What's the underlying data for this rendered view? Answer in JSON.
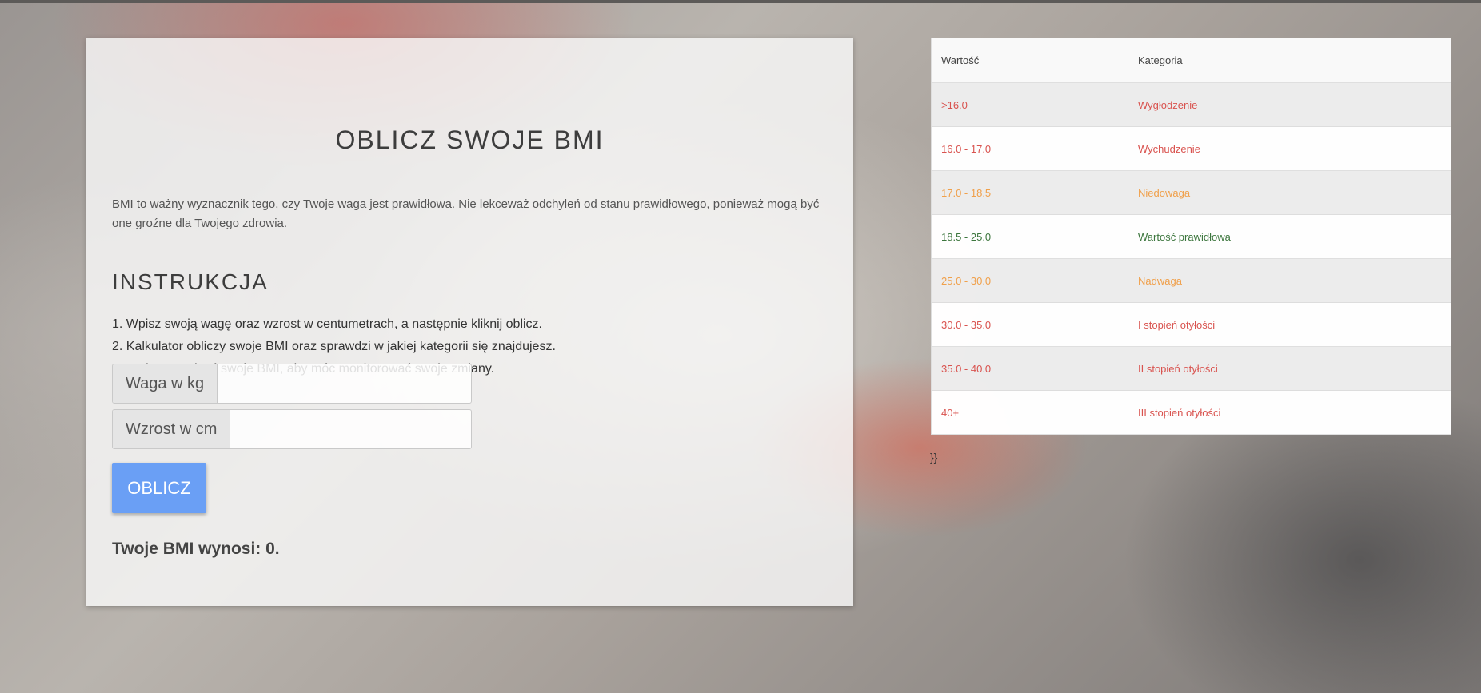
{
  "card": {
    "title": "OBLICZ SWOJE BMI",
    "intro": "BMI to ważny wyznacznik tego, czy Twoje waga jest prawidłowa. Nie lekceważ odchyleń od stanu prawidłowego, ponieważ mogą być one groźne dla Twojego zdrowia.",
    "instructions_title": "INSTRUKCJA",
    "steps": [
      "1. Wpisz swoją wagę oraz wzrost w centumetrach, a następnie kliknij oblicz.",
      "2. Kalkulator obliczy swoje BMI oraz sprawdzi w jakiej kategorii się znajdujesz.",
      "3. Możesz zapisać swoje BMI, aby móc monitorować swoje zmiany."
    ],
    "weight_label": "Waga w kg",
    "weight_value": "",
    "height_label": "Wzrost w cm",
    "height_value": "",
    "button_label": "OBLICZ",
    "result": "Twoje BMI wynosi: 0."
  },
  "table": {
    "headers": [
      "Wartość",
      "Kategoria"
    ],
    "rows": [
      {
        "value": ">16.0",
        "category": "Wygłodzenie",
        "color": "#d9534f"
      },
      {
        "value": "16.0 - 17.0",
        "category": "Wychudzenie",
        "color": "#d9534f"
      },
      {
        "value": "17.0 - 18.5",
        "category": "Niedowaga",
        "color": "#f0a04b"
      },
      {
        "value": "18.5 - 25.0",
        "category": "Wartość prawidłowa",
        "color": "#3c763d"
      },
      {
        "value": "25.0 - 30.0",
        "category": "Nadwaga",
        "color": "#f0a04b"
      },
      {
        "value": "30.0 - 35.0",
        "category": "I stopień otyłości",
        "color": "#d9534f"
      },
      {
        "value": "35.0 - 40.0",
        "category": "II stopień otyłości",
        "color": "#d9534f"
      },
      {
        "value": "40+",
        "category": "III stopień otyłości",
        "color": "#d9534f"
      }
    ]
  },
  "stray_text": "}}"
}
